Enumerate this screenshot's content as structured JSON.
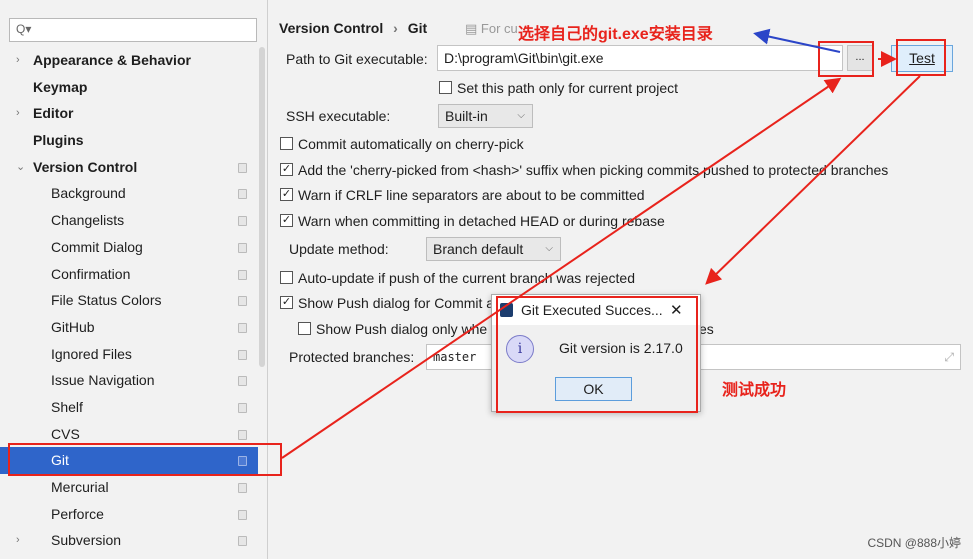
{
  "sidebar": {
    "search_placeholder": "Q▾",
    "items": [
      {
        "label": "Appearance & Behavior",
        "level": 0,
        "arrow": "›"
      },
      {
        "label": "Keymap",
        "level": 0
      },
      {
        "label": "Editor",
        "level": 0,
        "arrow": "›"
      },
      {
        "label": "Plugins",
        "level": 0
      },
      {
        "label": "Version Control",
        "level": 0,
        "arrow": "⌄",
        "cfg": true
      },
      {
        "label": "Background",
        "level": 1,
        "cfg": true
      },
      {
        "label": "Changelists",
        "level": 1,
        "cfg": true
      },
      {
        "label": "Commit Dialog",
        "level": 1,
        "cfg": true
      },
      {
        "label": "Confirmation",
        "level": 1,
        "cfg": true
      },
      {
        "label": "File Status Colors",
        "level": 1,
        "cfg": true
      },
      {
        "label": "GitHub",
        "level": 1,
        "cfg": true
      },
      {
        "label": "Ignored Files",
        "level": 1,
        "cfg": true
      },
      {
        "label": "Issue Navigation",
        "level": 1,
        "cfg": true
      },
      {
        "label": "Shelf",
        "level": 1,
        "cfg": true
      },
      {
        "label": "CVS",
        "level": 1,
        "cfg": true
      },
      {
        "label": "Git",
        "level": 1,
        "cfg": true,
        "selected": true
      },
      {
        "label": "Mercurial",
        "level": 1,
        "cfg": true
      },
      {
        "label": "Perforce",
        "level": 1,
        "cfg": true
      },
      {
        "label": "Subversion",
        "level": 1,
        "arrow": "›",
        "cfg": true
      }
    ]
  },
  "breadcrumb": {
    "parent": "Version Control",
    "sep": "›",
    "current": "Git",
    "scope": "For cu"
  },
  "form": {
    "path_label": "Path to Git executable:",
    "path_value": "D:\\program\\Git\\bin\\git.exe",
    "browse_label": "...",
    "test_label": "Test",
    "path_only_project": "Set this path only for current project",
    "ssh_label": "SSH executable:",
    "ssh_value": "Built-in",
    "cherry_pick": "Commit automatically on cherry-pick",
    "cherry_suffix": "Add the 'cherry-picked from <hash>' suffix when picking commits pushed to protected branches",
    "crlf": "Warn if CRLF line separators are about to be committed",
    "detached": "Warn when committing in detached HEAD or during rebase",
    "update_label": "Update method:",
    "update_value": "Branch default",
    "auto_update": "Auto-update if push of the current branch was rejected",
    "show_push": "Show Push dialog for Commit a",
    "show_push_only": "Show Push dialog only whe",
    "show_push_only_tail": "es",
    "protected_label": "Protected branches:",
    "protected_value": "master"
  },
  "dialog": {
    "title": "Git Executed Succes...",
    "close": "✕",
    "message": "Git version is 2.17.0",
    "ok": "OK"
  },
  "annotations": {
    "choose_dir": "选择自己的git.exe安装目录",
    "test_success": "测试成功",
    "watermark": "CSDN @888小婷"
  },
  "colors": {
    "selection": "#2f65ca",
    "annotation": "#e8231c",
    "arrow_blue": "#2b45c8"
  }
}
